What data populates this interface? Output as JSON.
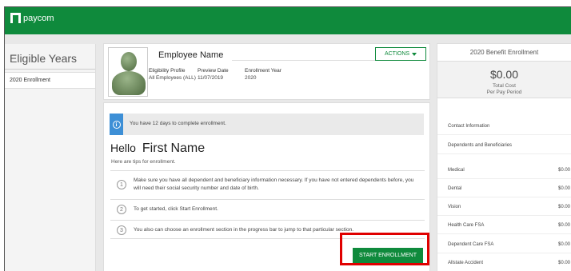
{
  "app": {
    "brand": "paycom",
    "brand_color": "#0f8a3c"
  },
  "left": {
    "title": "Eligible Years",
    "items": [
      {
        "label": "2020 Enrollment"
      }
    ]
  },
  "profile": {
    "name": "Employee Name",
    "actions_label": "ACTIONS",
    "eligibility_label": "Eligibility Profile",
    "eligibility_value": "All Employees (ALL)",
    "preview_label": "Preview Date",
    "preview_value": "11/07/2019",
    "year_label": "Enrollment Year",
    "year_value": "2020"
  },
  "main": {
    "notice": "You have 12 days to complete enrollment.",
    "hello": "Hello",
    "first_name": "First Name",
    "tips_intro": "Here are tips for enrollment.",
    "steps": [
      {
        "num": "1",
        "text": "Make sure you have all dependent and beneficiary information necessary. If you have not entered dependents before, you will need their social security number and date of birth."
      },
      {
        "num": "2",
        "text": "To get started, click Start Enrollment."
      },
      {
        "num": "3",
        "text": "You also can choose an enrollment section in the progress bar to jump to that particular section."
      }
    ],
    "start_button": "START ENROLLMENT"
  },
  "summary": {
    "title": "2020 Benefit Enrollment",
    "total": "$0.00",
    "total_label_1": "Total Cost",
    "total_label_2": "Per Pay Period",
    "sections": [
      {
        "label": "Contact Information"
      },
      {
        "label": "Dependents and Beneficiaries"
      }
    ],
    "benefits": [
      {
        "label": "Medical",
        "value": "$0.00"
      },
      {
        "label": "Dental",
        "value": "$0.00"
      },
      {
        "label": "Vision",
        "value": "$0.00"
      },
      {
        "label": "Health Care FSA",
        "value": "$0.00"
      },
      {
        "label": "Dependent Care FSA",
        "value": "$0.00"
      },
      {
        "label": "Allstate Accident",
        "value": "$0.00"
      }
    ]
  }
}
